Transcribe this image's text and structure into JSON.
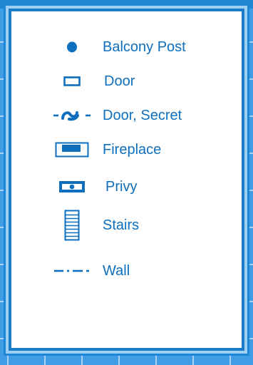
{
  "legend": {
    "items": [
      {
        "key": "balcony_post",
        "label": "Balcony Post",
        "icon": "balcony-post-icon"
      },
      {
        "key": "door",
        "label": "Door",
        "icon": "door-icon"
      },
      {
        "key": "secret_door",
        "label": "Door, Secret",
        "icon": "secret-door-icon"
      },
      {
        "key": "fireplace",
        "label": "Fireplace",
        "icon": "fireplace-icon"
      },
      {
        "key": "privy",
        "label": "Privy",
        "icon": "privy-icon"
      },
      {
        "key": "stairs",
        "label": "Stairs",
        "icon": "stairs-icon"
      },
      {
        "key": "wall",
        "label": "Wall",
        "icon": "wall-icon"
      }
    ]
  },
  "colors": {
    "symbol": "#0d6fbd",
    "frame": "#1d7cc8",
    "background_grid": "#3f9de6"
  }
}
